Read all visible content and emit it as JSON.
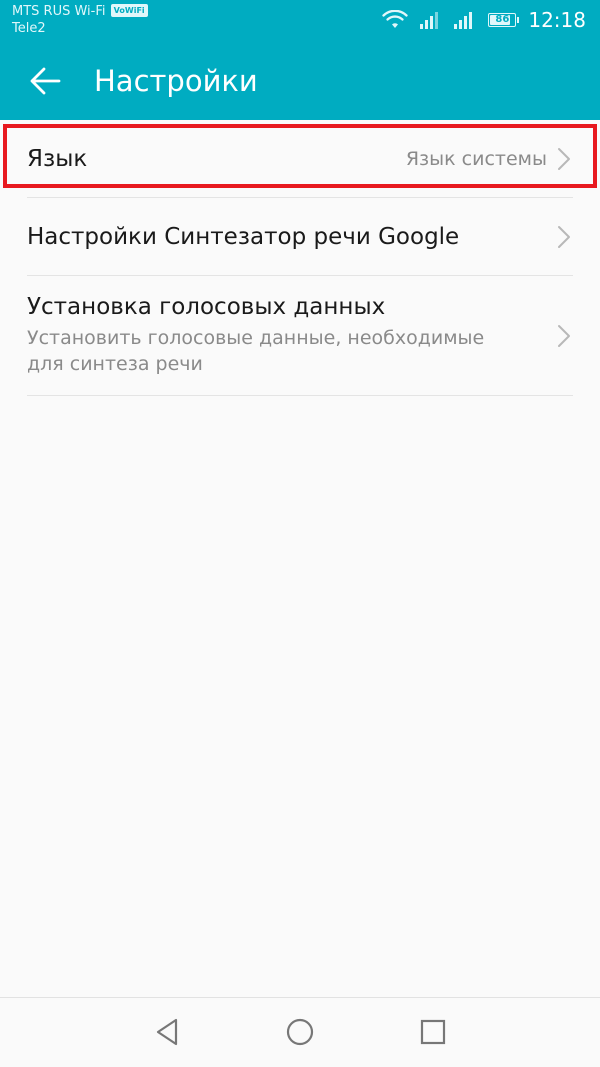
{
  "status_bar": {
    "carrier_1": "MTS RUS Wi-Fi",
    "vowifi_badge": "VoWiFi",
    "carrier_2": "Tele2",
    "battery_level": "86",
    "battery_percent": 86,
    "time": "12:18",
    "icons": [
      "wifi-icon",
      "signal-icon",
      "signal-icon",
      "battery-icon"
    ]
  },
  "app_bar": {
    "title": "Настройки",
    "back_icon": "arrow-left-icon"
  },
  "settings": {
    "language": {
      "title": "Язык",
      "value": "Язык системы"
    },
    "tts_settings": {
      "title": "Настройки Синтезатор речи Google"
    },
    "voice_data": {
      "title": "Установка голосовых данных",
      "summary": "Установить голосовые данные, необходимые для синтеза речи"
    }
  },
  "navigation": {
    "icons": [
      "back-triangle-icon",
      "home-circle-icon",
      "recents-square-icon"
    ]
  },
  "colors": {
    "accent": "#00acc1",
    "highlight": "#e8191f",
    "background": "#fafafa",
    "primary_text": "#1a1a1a",
    "secondary_text": "#8a8a8a"
  }
}
